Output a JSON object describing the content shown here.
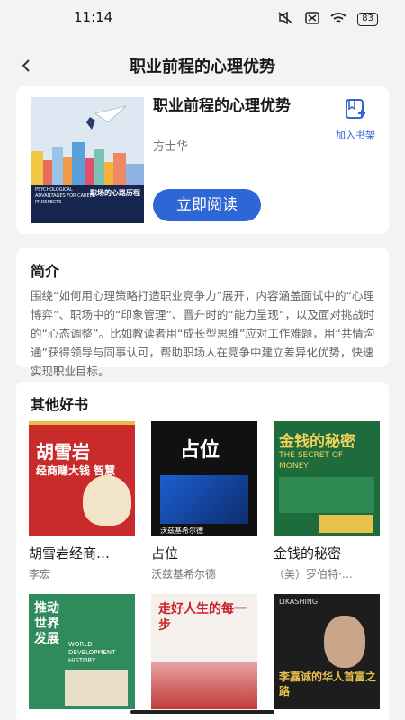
{
  "status": {
    "time": "11:14",
    "battery": "83"
  },
  "nav": {
    "title": "职业前程的心理优势"
  },
  "book": {
    "title": "职业前程的心理优势",
    "author": "方士华",
    "read_label": "立即阅读",
    "shelf_label": "加入书架",
    "cover_title_en": "PSYCHOLOGICAL ADVANTAGES FOR CAREER PROSPECTS",
    "cover_title_cn": "职场的心路历程"
  },
  "intro": {
    "title": "简介",
    "text": "围绕“如何用心理策略打造职业竞争力”展开，内容涵盖面试中的“心理博弈”、职场中的“印象管理”、晋升时的“能力呈现”，以及面对挑战时的“心态调整”。比如教读者用“成长型思维”应对工作难题，用“共情沟通”获得领导与同事认可，帮助职场人在竞争中建立差异化优势，快速实现职业目标。"
  },
  "others": {
    "title": "其他好书",
    "books": [
      {
        "title": "胡雪岩经商…",
        "author": "李宏",
        "cover_text": "胡雪岩",
        "cover_sub": "经商赚大钱 智慧"
      },
      {
        "title": "占位",
        "author": "沃兹基希尔德",
        "cover_text": "占位",
        "cover_sub": "沃兹基希尔德"
      },
      {
        "title": "金钱的秘密",
        "author": "（美）罗伯特·…",
        "cover_text": "金钱的秘密",
        "cover_sub": "THE SECRET OF MONEY"
      },
      {
        "cover_text": "推动世界发展",
        "cover_sub": "WORLD DEVELOPMENT HISTORY"
      },
      {
        "cover_text": "走好人生的每一步",
        "cover_sub": ""
      },
      {
        "cover_text": "李嘉诚的华人首富之路",
        "cover_sub": "LIKASHING"
      }
    ]
  }
}
